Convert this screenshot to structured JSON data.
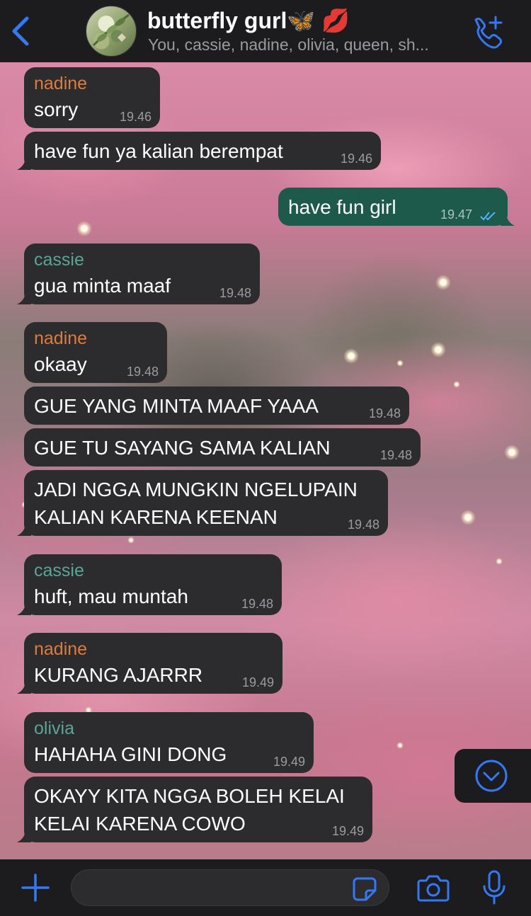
{
  "header": {
    "title": "butterfly gurl🦋 💋",
    "subtitle": "You, cassie, nadine, olivia, queen, sh..."
  },
  "colors": {
    "accent": "#3478f6",
    "incoming_bubble": "#2c2c2e",
    "outgoing_bubble": "#1d5a4c",
    "nadine": "#e07b39",
    "cassie": "#5aa596",
    "olivia": "#5aa596"
  },
  "icons": {
    "back": "chevron-left-icon",
    "call": "phone-plus-icon",
    "scroll": "chevron-down-circle-icon",
    "plus": "plus-icon",
    "sticker": "sticker-icon",
    "camera": "camera-icon",
    "mic": "microphone-icon"
  },
  "messages": [
    {
      "sender": "nadine",
      "text": "sorry",
      "time": "19.46"
    },
    {
      "sender": "",
      "text": "have fun ya kalian berempat",
      "time": "19.46"
    },
    {
      "sender": "",
      "text": "have fun girl",
      "time": "19.47",
      "read": true
    },
    {
      "sender": "cassie",
      "text": "gua minta maaf",
      "time": "19.48"
    },
    {
      "sender": "nadine",
      "text": "okaay",
      "time": "19.48"
    },
    {
      "sender": "",
      "text": "GUE YANG MINTA MAAF YAAA",
      "time": "19.48"
    },
    {
      "sender": "",
      "text": "GUE TU SAYANG SAMA KALIAN",
      "time": "19.48"
    },
    {
      "sender": "",
      "text": "JADI NGGA MUNGKIN NGELUPAIN\nKALIAN KARENA KEENAN",
      "time": "19.48"
    },
    {
      "sender": "cassie",
      "text": "huft, mau muntah",
      "time": "19.48"
    },
    {
      "sender": "nadine",
      "text": "KURANG AJARRR",
      "time": "19.49"
    },
    {
      "sender": "olivia",
      "text": "HAHAHA GINI DONG",
      "time": "19.49"
    },
    {
      "sender": "",
      "text": "OKAYY KITA NGGA BOLEH KELAI\nKELAI KARENA COWO",
      "time": "19.49"
    }
  ],
  "composer": {
    "value": "",
    "placeholder": ""
  }
}
